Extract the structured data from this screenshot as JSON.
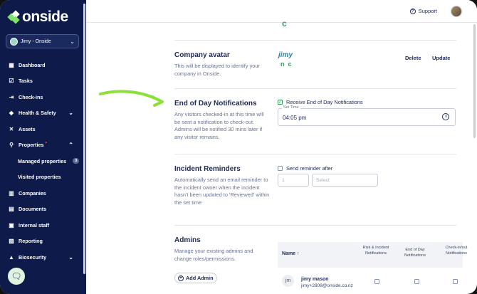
{
  "sidebar": {
    "logo": "onside",
    "org_select": "Jimy - Onside",
    "items": [
      {
        "label": "Dashboard"
      },
      {
        "label": "Tasks"
      },
      {
        "label": "Check-ins"
      },
      {
        "label": "Health & Safety"
      },
      {
        "label": "Assets"
      },
      {
        "label": "Properties"
      },
      {
        "label": "Managed properties",
        "badge": "3"
      },
      {
        "label": "Visited properties"
      },
      {
        "label": "Companies"
      },
      {
        "label": "Documents"
      },
      {
        "label": "Internal staff"
      },
      {
        "label": "Reporting"
      },
      {
        "label": "Biosecurity"
      }
    ]
  },
  "header": {
    "support_label": "Support"
  },
  "company_avatar": {
    "title": "Company avatar",
    "description": "This will be displayed to identify your company in Onside.",
    "logo_top": "jimy",
    "logo_bottom": "nc",
    "delete_label": "Delete",
    "update_label": "Update",
    "prev_fragment": "c"
  },
  "eod": {
    "title": "End of Day Notifications",
    "description": "Any visitors checked-in at this time will be sent a notification to check-out. Admins will be notified 30 mins later if any visitor remains.",
    "checkbox_label": "Receive End of Day Notifications",
    "checkbox_checked": true,
    "time_label": "Set Time",
    "time_value": "04:05 pm"
  },
  "incident": {
    "title": "Incident Reminders",
    "description": "Automatically send an email reminder to the incident owner when the incident hasn't been updated to 'Reviewed' within the set time",
    "checkbox_label": "Send reminder after",
    "checkbox_checked": false,
    "number_placeholder": "1",
    "unit_placeholder": "Select"
  },
  "admins": {
    "title": "Admins",
    "description": "Manage your existing admins and change roles/permissions.",
    "add_label": "Add Admin",
    "columns": [
      "Name ↑",
      "Risk & Incident Notifications",
      "End of Day Notifications",
      "Check-in/out Notifications"
    ],
    "rows": [
      {
        "initials": "jm",
        "name": "jimy mason",
        "email": "jimy+2808@onside.co.nz"
      }
    ]
  }
}
